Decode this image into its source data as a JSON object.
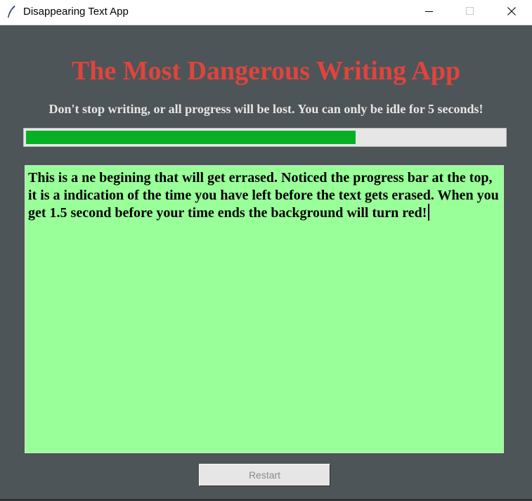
{
  "window": {
    "title": "Disappearing Text App",
    "icon": "feather-icon",
    "controls": [
      "minimize-icon",
      "maximize-icon",
      "close-icon"
    ]
  },
  "app": {
    "heading": "The Most Dangerous Writing App",
    "heading_color": "#e0443c",
    "subheading": "Don't stop writing, or all progress will be lost. You can only be idle for 5 seconds!",
    "progress": {
      "fraction": 0.69,
      "color": "#06b025",
      "track_color": "#e6e6e6"
    },
    "editor": {
      "text": "This is a ne begining that will get errased. Noticed the progress bar at the top, it is a indication of the time you have left before the text gets erased. When you get 1.5 second before your time ends the background will turn red!",
      "background": "#99ff99"
    },
    "restart_label": "Restart"
  },
  "colors": {
    "window_background": "#4e5558"
  }
}
